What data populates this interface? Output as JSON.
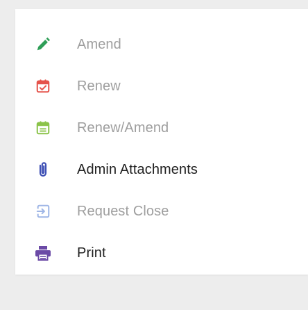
{
  "menu": {
    "items": [
      {
        "label": "Amend",
        "icon": "pencil-icon",
        "icon_color": "#2e9e57",
        "enabled": false
      },
      {
        "label": "Renew",
        "icon": "calendar-check-icon",
        "icon_color": "#e5534b",
        "enabled": false
      },
      {
        "label": "Renew/Amend",
        "icon": "calendar-list-icon",
        "icon_color": "#8bc34a",
        "enabled": false
      },
      {
        "label": "Admin Attachments",
        "icon": "paperclip-icon",
        "icon_color": "#3f51b5",
        "enabled": true
      },
      {
        "label": "Request Close",
        "icon": "sign-in-icon",
        "icon_color": "#9fb6e6",
        "enabled": false
      },
      {
        "label": "Print",
        "icon": "printer-icon",
        "icon_color": "#6b4aa6",
        "enabled": true
      }
    ]
  },
  "colors": {
    "background": "#ededed",
    "panel": "#ffffff",
    "disabled_text": "#9e9e9e",
    "enabled_text": "#212121"
  }
}
